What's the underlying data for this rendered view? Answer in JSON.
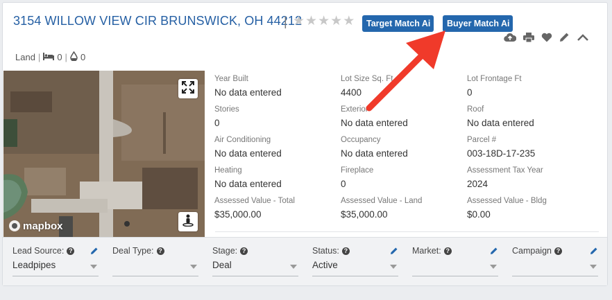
{
  "header": {
    "address": "3154 WILLOW VIEW CIR BRUNSWICK, OH 44212",
    "separator": "|",
    "rating": 0,
    "target_match_label": "Target Match Ai",
    "buyer_match_label": "Buyer Match Ai"
  },
  "toolbar_icons": [
    "cloud-upload-icon",
    "print-icon",
    "heart-icon",
    "pencil-icon",
    "chevron-up-icon"
  ],
  "meta": {
    "type": "Land",
    "beds": "0",
    "baths": "0"
  },
  "map": {
    "brand": "mapbox"
  },
  "details": [
    {
      "label": "Year Built",
      "value": "No data entered"
    },
    {
      "label": "Lot Size Sq. Ft",
      "value": "4400"
    },
    {
      "label": "Lot Frontage Ft",
      "value": "0"
    },
    {
      "label": "Stories",
      "value": "0"
    },
    {
      "label": "Exterior",
      "value": "No data entered"
    },
    {
      "label": "Roof",
      "value": "No data entered"
    },
    {
      "label": "Air Conditioning",
      "value": "No data entered"
    },
    {
      "label": "Occupancy",
      "value": "No data entered"
    },
    {
      "label": "Parcel #",
      "value": "003-18D-17-235"
    },
    {
      "label": "Heating",
      "value": "No data entered"
    },
    {
      "label": "Fireplace",
      "value": "0"
    },
    {
      "label": "Assessment Tax Year",
      "value": "2024"
    },
    {
      "label": "Assessed Value - Total",
      "value": "$35,000.00"
    },
    {
      "label": "Assessed Value - Land",
      "value": "$35,000.00"
    },
    {
      "label": "Assessed Value - Bldg",
      "value": "$0.00"
    }
  ],
  "footer": [
    {
      "label": "Lead Source:",
      "value": "Leadpipes",
      "editable": true
    },
    {
      "label": "Deal Type:",
      "value": "",
      "editable": false
    },
    {
      "label": "Stage:",
      "value": "Deal",
      "editable": false
    },
    {
      "label": "Status:",
      "value": "Active",
      "editable": true
    },
    {
      "label": "Market:",
      "value": "",
      "editable": true
    },
    {
      "label": "Campaign",
      "value": "",
      "editable": true
    }
  ],
  "colors": {
    "accent": "#2467ad",
    "link": "#2660a4",
    "arrow": "#f03a2a"
  }
}
